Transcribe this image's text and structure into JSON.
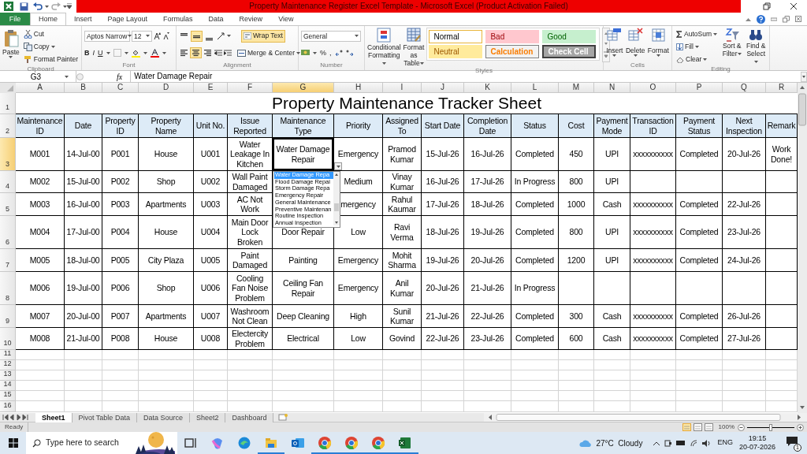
{
  "window": {
    "title": "Property Maintenance Register Excel Template  -  Microsoft Excel (Product Activation Failed)"
  },
  "ribbon_tabs": [
    {
      "label": "File",
      "kind": "file",
      "selected": false
    },
    {
      "label": "Home",
      "kind": "tab",
      "selected": true
    },
    {
      "label": "Insert",
      "kind": "tab",
      "selected": false
    },
    {
      "label": "Page Layout",
      "kind": "tab",
      "selected": false
    },
    {
      "label": "Formulas",
      "kind": "tab",
      "selected": false
    },
    {
      "label": "Data",
      "kind": "tab",
      "selected": false
    },
    {
      "label": "Review",
      "kind": "tab",
      "selected": false
    },
    {
      "label": "View",
      "kind": "tab",
      "selected": false
    }
  ],
  "clipboard": {
    "label": "Clipboard",
    "paste": "Paste",
    "cut": "Cut",
    "copy": "Copy",
    "format_painter": "Format Painter"
  },
  "font": {
    "label": "Font",
    "name": "Aptos Narrow",
    "size": "12",
    "bold": "B",
    "italic": "I",
    "underline": "U"
  },
  "alignment": {
    "label": "Alignment",
    "vertical": [
      {
        "selected": false
      },
      {
        "selected": true
      },
      {
        "selected": false
      }
    ],
    "horizontal": [
      {
        "selected": false
      },
      {
        "selected": true
      },
      {
        "selected": false
      }
    ],
    "wrap_text": {
      "label": "Wrap Text",
      "on": true
    },
    "merge": "Merge & Center"
  },
  "number": {
    "label": "Number",
    "format": "General",
    "percent": "%",
    "comma": ","
  },
  "styles": {
    "label": "Styles",
    "conditional": "Conditional Formatting",
    "format_table": "Format as Table",
    "cell_styles": [
      {
        "name": "Normal",
        "kind": "normal",
        "selected": true
      },
      {
        "name": "Bad",
        "kind": "bad",
        "selected": false
      },
      {
        "name": "Good",
        "kind": "good",
        "selected": false
      },
      {
        "name": "Neutral",
        "kind": "neutral",
        "selected": false
      },
      {
        "name": "Calculation",
        "kind": "calculation",
        "selected": false
      },
      {
        "name": "Check Cell",
        "kind": "check",
        "selected": false
      }
    ]
  },
  "cells": {
    "label": "Cells",
    "buttons": [
      "Insert",
      "Delete",
      "Format"
    ]
  },
  "editing": {
    "label": "Editing",
    "autosum": "AutoSum",
    "fill": "Fill",
    "clear": "Clear",
    "sort": "Sort & Filter",
    "find": "Find & Select"
  },
  "formula_bar": {
    "name_box": "G3",
    "function_label": "fx",
    "formula": "Water Damage Repair"
  },
  "spreadsheet": {
    "columns": [
      {
        "label": "A",
        "selected": false
      },
      {
        "label": "B",
        "selected": false
      },
      {
        "label": "C",
        "selected": false
      },
      {
        "label": "D",
        "selected": false
      },
      {
        "label": "E",
        "selected": false
      },
      {
        "label": "F",
        "selected": false
      },
      {
        "label": "G",
        "selected": true
      },
      {
        "label": "H",
        "selected": false
      },
      {
        "label": "I",
        "selected": false
      },
      {
        "label": "J",
        "selected": false
      },
      {
        "label": "K",
        "selected": false
      },
      {
        "label": "L",
        "selected": false
      },
      {
        "label": "M",
        "selected": false
      },
      {
        "label": "N",
        "selected": false
      },
      {
        "label": "O",
        "selected": false
      },
      {
        "label": "P",
        "selected": false
      },
      {
        "label": "Q",
        "selected": false
      },
      {
        "label": "R",
        "selected": false
      }
    ],
    "rows": [
      {
        "number": "1",
        "kind": "title",
        "selected": false,
        "text": "Property Maintenance Tracker Sheet"
      },
      {
        "number": "2",
        "kind": "header",
        "selected": false,
        "cells": [
          "Maintenance ID",
          "Date",
          "Property ID",
          "Property Name",
          "Unit No.",
          "Issue Reported",
          "Maintenance Type",
          "Priority",
          "Assigned To",
          "Start Date",
          "Completion Date",
          "Status",
          "Cost",
          "Payment Mode",
          "Transaction ID",
          "Payment Status",
          "Next Inspection",
          "Remark"
        ]
      },
      {
        "number": "3",
        "kind": "data",
        "selected": true,
        "cells": [
          "M001",
          "14-Jul-00",
          "P001",
          "House",
          "U001",
          "Water Leakage In Kitchen",
          "Water Damage Repair",
          "Emergency",
          "Pramod Kumar",
          "15-Jul-26",
          "16-Jul-26",
          "Completed",
          "450",
          "UPI",
          "xxxxxxxxxx",
          "Completed",
          "20-Jul-26",
          "Work Done!"
        ]
      },
      {
        "number": "4",
        "kind": "data",
        "selected": false,
        "cells": [
          "M002",
          "15-Jul-00",
          "P002",
          "Shop",
          "U002",
          "Wall Paint Damaged",
          null,
          "Medium",
          "Vinay Kumar",
          "16-Jul-26",
          "17-Jul-26",
          "In Progress",
          "800",
          "UPI",
          null,
          null,
          null,
          null
        ]
      },
      {
        "number": "5",
        "kind": "data",
        "selected": false,
        "cells": [
          "M003",
          "16-Jul-00",
          "P003",
          "Apartments",
          "U003",
          "AC Not Work",
          null,
          "mergency",
          "Rahul Kaumar",
          "17-Jul-26",
          "18-Jul-26",
          "Completed",
          "1000",
          "Cash",
          "xxxxxxxxxx",
          "Completed",
          "22-Jul-26",
          null
        ]
      },
      {
        "number": "6",
        "kind": "data",
        "selected": false,
        "cells": [
          "M004",
          "17-Jul-00",
          "P004",
          "House",
          "U004",
          "Main Door Lock Broken",
          "Door Repair",
          "Low",
          "Ravi Verma",
          "18-Jul-26",
          "19-Jul-26",
          "Completed",
          "800",
          "UPI",
          "xxxxxxxxxx",
          "Completed",
          "23-Jul-26",
          null
        ]
      },
      {
        "number": "7",
        "kind": "data",
        "selected": false,
        "cells": [
          "M005",
          "18-Jul-00",
          "P005",
          "City Plaza",
          "U005",
          "Paint Damaged",
          "Painting",
          "Emergency",
          "Mohit Sharma",
          "19-Jul-26",
          "20-Jul-26",
          "Completed",
          "1200",
          "UPI",
          "xxxxxxxxxx",
          "Completed",
          "24-Jul-26",
          null
        ]
      },
      {
        "number": "8",
        "kind": "data",
        "selected": false,
        "cells": [
          "M006",
          "19-Jul-00",
          "P006",
          "Shop",
          "U006",
          "Cooling Fan Noise Problem",
          "Ceiling Fan Repair",
          "Emergency",
          "Anil Kumar",
          "20-Jul-26",
          "21-Jul-26",
          "In Progress",
          null,
          null,
          null,
          null,
          null,
          null
        ]
      },
      {
        "number": "9",
        "kind": "data",
        "selected": false,
        "cells": [
          "M007",
          "20-Jul-00",
          "P007",
          "Apartments",
          "U007",
          "Washroom Not Clean",
          "Deep Cleaning",
          "High",
          "Sunil Kumar",
          "21-Jul-26",
          "22-Jul-26",
          "Completed",
          "300",
          "Cash",
          "xxxxxxxxxx",
          "Completed",
          "26-Jul-26",
          null
        ]
      },
      {
        "number": "10",
        "kind": "data",
        "selected": false,
        "cells": [
          "M008",
          "21-Jul-00",
          "P008",
          "House",
          "U008",
          "Electercity Problem",
          "Electrical",
          "Low",
          "Govind",
          "22-Jul-26",
          "23-Jul-26",
          "Completed",
          "600",
          "Cash",
          "xxxxxxxxxx",
          "Completed",
          "27-Jul-26",
          null
        ]
      },
      {
        "number": "11",
        "kind": "empty",
        "selected": false
      },
      {
        "number": "12",
        "kind": "empty",
        "selected": false
      },
      {
        "number": "13",
        "kind": "empty",
        "selected": false
      },
      {
        "number": "14",
        "kind": "empty",
        "selected": false
      },
      {
        "number": "15",
        "kind": "empty",
        "selected": false
      },
      {
        "number": "16",
        "kind": "empty",
        "selected": false
      }
    ],
    "validation_list": [
      {
        "label": "Water Damage Repa",
        "selected": true
      },
      {
        "label": "Flood Damage Repai",
        "selected": false
      },
      {
        "label": "Storm Damage Repa",
        "selected": false
      },
      {
        "label": "Emergency Repair",
        "selected": false
      },
      {
        "label": "General Maintenance",
        "selected": false
      },
      {
        "label": "Preventive Maintenan",
        "selected": false
      },
      {
        "label": "Routine Inspection",
        "selected": false
      },
      {
        "label": "Annual Inspection",
        "selected": false
      }
    ]
  },
  "sheet_tabs": [
    {
      "label": "Sheet1",
      "selected": true
    },
    {
      "label": "Pivot Table Data",
      "selected": false
    },
    {
      "label": "Data Source",
      "selected": false
    },
    {
      "label": "Sheet2",
      "selected": false
    },
    {
      "label": "Dashboard",
      "selected": false
    }
  ],
  "status_bar": {
    "status": "Ready",
    "views": [
      {
        "selected": true
      },
      {
        "selected": false
      },
      {
        "selected": false
      }
    ],
    "zoom": {
      "reading": "100%",
      "level": 0.5
    }
  },
  "taskbar": {
    "search": {
      "placeholder": "Type here to search"
    },
    "apps": [
      {
        "kind": "task-view",
        "running": false
      },
      {
        "kind": "copilot",
        "running": false
      },
      {
        "kind": "edge",
        "running": false
      },
      {
        "kind": "explorer",
        "running": true
      },
      {
        "kind": "outlook",
        "running": false
      },
      {
        "kind": "chrome",
        "running": true
      },
      {
        "kind": "chrome",
        "running": true
      },
      {
        "kind": "chrome",
        "running": true
      },
      {
        "kind": "excel",
        "running": true
      }
    ],
    "weather": "27°C  Cloudy",
    "language": "ENG",
    "time": "19:15",
    "date": "20-07-2026",
    "notifications": "1"
  }
}
